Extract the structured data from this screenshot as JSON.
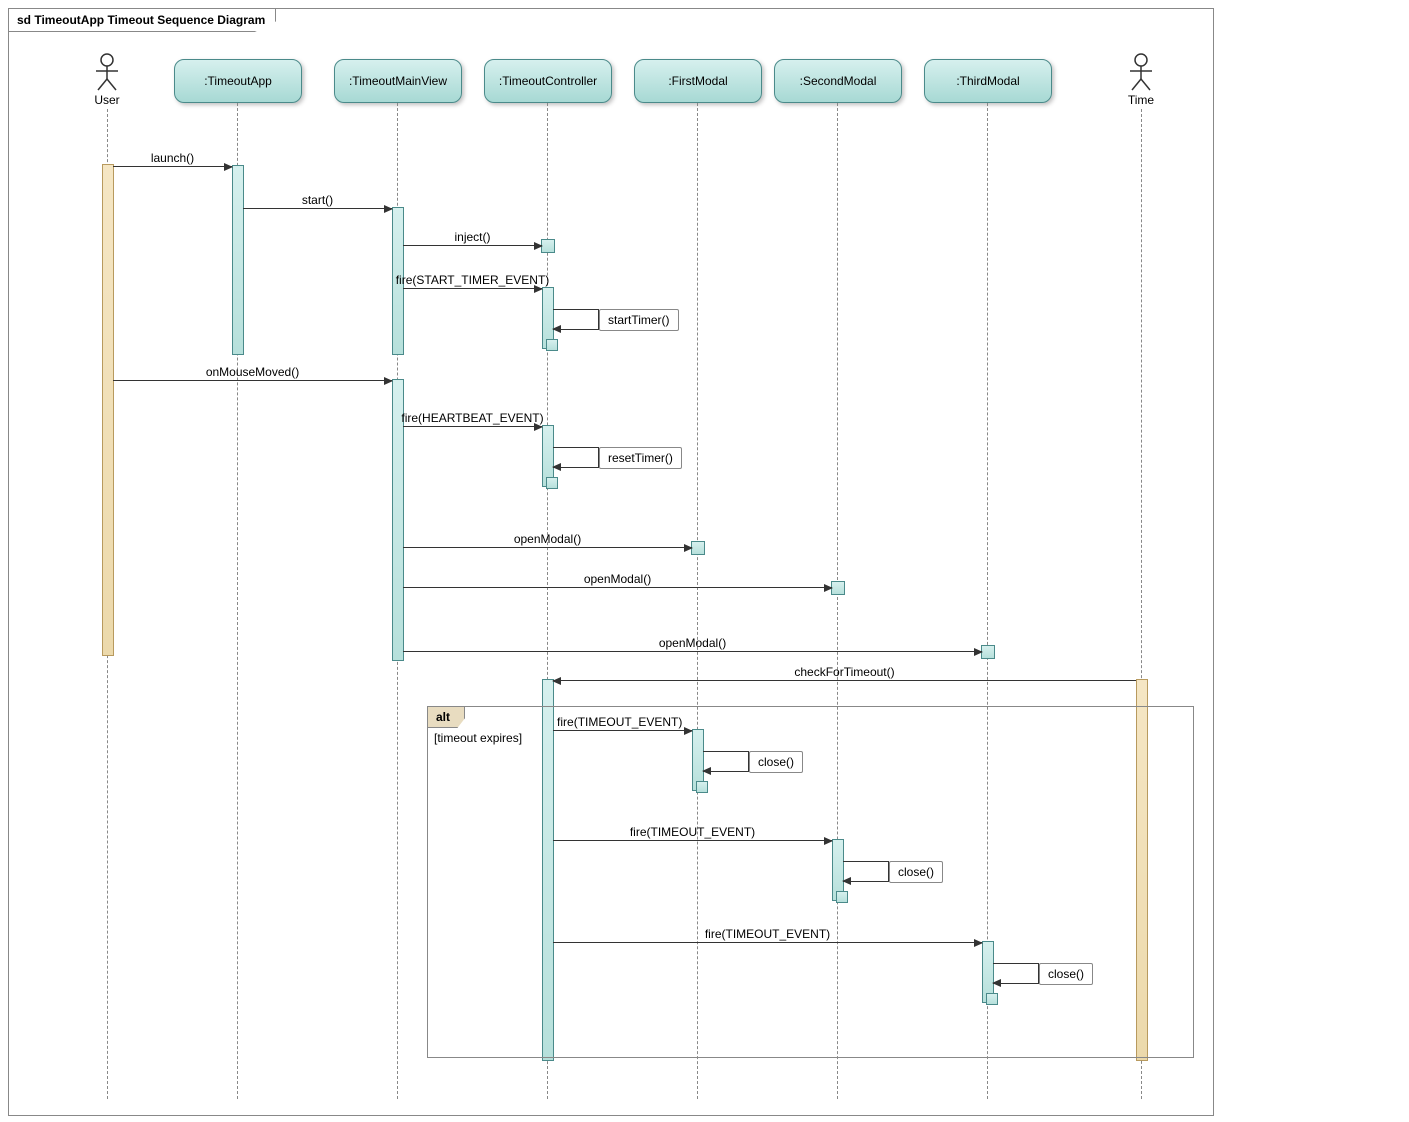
{
  "title": "sd TimeoutApp Timeout Sequence Diagram",
  "actors": {
    "user": {
      "label": "User"
    },
    "time": {
      "label": "Time"
    }
  },
  "lifelines": {
    "timeoutApp": {
      "label": ":TimeoutApp"
    },
    "timeoutMainView": {
      "label": ":TimeoutMainView"
    },
    "timeoutController": {
      "label": ":TimeoutController"
    },
    "firstModal": {
      "label": ":FirstModal"
    },
    "secondModal": {
      "label": ":SecondModal"
    },
    "thirdModal": {
      "label": ":ThirdModal"
    }
  },
  "messages": {
    "m1": {
      "from": "User",
      "to": "TimeoutApp",
      "label": "launch()"
    },
    "m2": {
      "from": "TimeoutApp",
      "to": "TimeoutMainView",
      "label": "start()"
    },
    "m3": {
      "from": "TimeoutMainView",
      "to": "TimeoutController",
      "label": "inject()"
    },
    "m4": {
      "from": "TimeoutMainView",
      "to": "TimeoutController",
      "label": "fire(START_TIMER_EVENT)"
    },
    "m5": {
      "from": "TimeoutController",
      "to": "TimeoutController",
      "label": "startTimer()"
    },
    "m6": {
      "from": "User",
      "to": "TimeoutMainView",
      "label": "onMouseMoved()"
    },
    "m7": {
      "from": "TimeoutMainView",
      "to": "TimeoutController",
      "label": "fire(HEARTBEAT_EVENT)"
    },
    "m8": {
      "from": "TimeoutController",
      "to": "TimeoutController",
      "label": "resetTimer()"
    },
    "m9": {
      "from": "TimeoutMainView",
      "to": "FirstModal",
      "label": "openModal()"
    },
    "m10": {
      "from": "TimeoutMainView",
      "to": "SecondModal",
      "label": "openModal()"
    },
    "m11": {
      "from": "TimeoutMainView",
      "to": "ThirdModal",
      "label": "openModal()"
    },
    "m12": {
      "from": "Time",
      "to": "TimeoutController",
      "label": "checkForTimeout()"
    },
    "m13": {
      "from": "TimeoutController",
      "to": "FirstModal",
      "label": "fire(TIMEOUT_EVENT)"
    },
    "m14": {
      "from": "FirstModal",
      "to": "FirstModal",
      "label": "close()"
    },
    "m15": {
      "from": "TimeoutController",
      "to": "SecondModal",
      "label": "fire(TIMEOUT_EVENT)"
    },
    "m16": {
      "from": "SecondModal",
      "to": "SecondModal",
      "label": "close()"
    },
    "m17": {
      "from": "TimeoutController",
      "to": "ThirdModal",
      "label": "fire(TIMEOUT_EVENT)"
    },
    "m18": {
      "from": "ThirdModal",
      "to": "ThirdModal",
      "label": "close()"
    }
  },
  "fragments": {
    "alt1": {
      "type": "alt",
      "label": "alt",
      "guard": "[timeout expires]"
    }
  },
  "layout": {
    "columns": {
      "user": 98,
      "timeoutApp": 228,
      "timeoutMainView": 388,
      "timeoutController": 538,
      "firstModal": 688,
      "secondModal": 828,
      "thirdModal": 978,
      "time": 1132
    }
  },
  "chart_data": {
    "type": "sequence-diagram",
    "title": "sd TimeoutApp Timeout Sequence Diagram",
    "participants": [
      {
        "name": "User",
        "kind": "actor"
      },
      {
        "name": "TimeoutApp",
        "kind": "object"
      },
      {
        "name": "TimeoutMainView",
        "kind": "object"
      },
      {
        "name": "TimeoutController",
        "kind": "object"
      },
      {
        "name": "FirstModal",
        "kind": "object"
      },
      {
        "name": "SecondModal",
        "kind": "object"
      },
      {
        "name": "ThirdModal",
        "kind": "object"
      },
      {
        "name": "Time",
        "kind": "actor"
      }
    ],
    "messages": [
      {
        "from": "User",
        "to": "TimeoutApp",
        "label": "launch()",
        "type": "sync"
      },
      {
        "from": "TimeoutApp",
        "to": "TimeoutMainView",
        "label": "start()",
        "type": "sync"
      },
      {
        "from": "TimeoutMainView",
        "to": "TimeoutController",
        "label": "inject()",
        "type": "sync"
      },
      {
        "from": "TimeoutMainView",
        "to": "TimeoutController",
        "label": "fire(START_TIMER_EVENT)",
        "type": "sync"
      },
      {
        "from": "TimeoutController",
        "to": "TimeoutController",
        "label": "startTimer()",
        "type": "self"
      },
      {
        "from": "User",
        "to": "TimeoutMainView",
        "label": "onMouseMoved()",
        "type": "sync"
      },
      {
        "from": "TimeoutMainView",
        "to": "TimeoutController",
        "label": "fire(HEARTBEAT_EVENT)",
        "type": "sync"
      },
      {
        "from": "TimeoutController",
        "to": "TimeoutController",
        "label": "resetTimer()",
        "type": "self"
      },
      {
        "from": "TimeoutMainView",
        "to": "FirstModal",
        "label": "openModal()",
        "type": "sync"
      },
      {
        "from": "TimeoutMainView",
        "to": "SecondModal",
        "label": "openModal()",
        "type": "sync"
      },
      {
        "from": "TimeoutMainView",
        "to": "ThirdModal",
        "label": "openModal()",
        "type": "sync"
      },
      {
        "from": "Time",
        "to": "TimeoutController",
        "label": "checkForTimeout()",
        "type": "sync"
      },
      {
        "from": "TimeoutController",
        "to": "FirstModal",
        "label": "fire(TIMEOUT_EVENT)",
        "type": "sync",
        "fragment": "alt1"
      },
      {
        "from": "FirstModal",
        "to": "FirstModal",
        "label": "close()",
        "type": "self",
        "fragment": "alt1"
      },
      {
        "from": "TimeoutController",
        "to": "SecondModal",
        "label": "fire(TIMEOUT_EVENT)",
        "type": "sync",
        "fragment": "alt1"
      },
      {
        "from": "SecondModal",
        "to": "SecondModal",
        "label": "close()",
        "type": "self",
        "fragment": "alt1"
      },
      {
        "from": "TimeoutController",
        "to": "ThirdModal",
        "label": "fire(TIMEOUT_EVENT)",
        "type": "sync",
        "fragment": "alt1"
      },
      {
        "from": "ThirdModal",
        "to": "ThirdModal",
        "label": "close()",
        "type": "self",
        "fragment": "alt1"
      }
    ],
    "fragments": [
      {
        "id": "alt1",
        "type": "alt",
        "guard": "[timeout expires]"
      }
    ]
  }
}
